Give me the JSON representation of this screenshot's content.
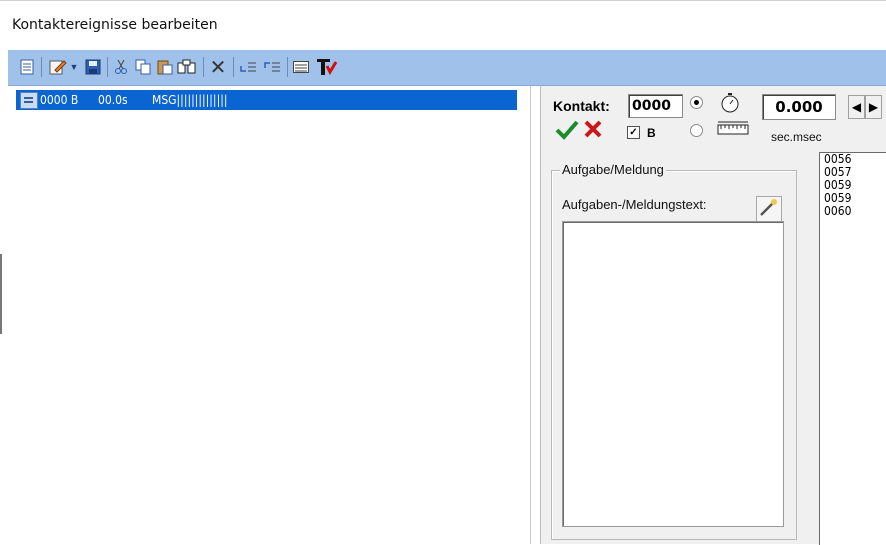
{
  "window": {
    "title": "Kontaktereignisse bearbeiten"
  },
  "toolbar": {
    "icons": [
      "new-page-icon",
      "edit-icon",
      "dropdown-arrow-icon",
      "save-icon",
      "cut-icon",
      "copy-icon",
      "paste-icon",
      "find-icon",
      "delete-icon",
      "insert-before-icon",
      "insert-after-icon",
      "grid-icon",
      "text-t-icon"
    ],
    "accent": "#9fc1ea"
  },
  "event_list": {
    "rows": [
      {
        "contact": "0000 B",
        "time": "00.0s",
        "message": "MSG||||||||||||||"
      }
    ],
    "selected_color": "#0a64d2"
  },
  "editor": {
    "kontakt_label": "Kontakt:",
    "kontakt_value": "0000",
    "time_value": "0.000",
    "b_label": "B",
    "b_checked": true,
    "unit_label": "sec.msec",
    "group_title": "Aufgabe/Meldung",
    "text_label": "Aufgaben-/Meldungstext:",
    "text_value": ""
  },
  "contact_numbers": [
    "0056",
    "0057",
    "0059",
    "0059",
    "0060"
  ]
}
